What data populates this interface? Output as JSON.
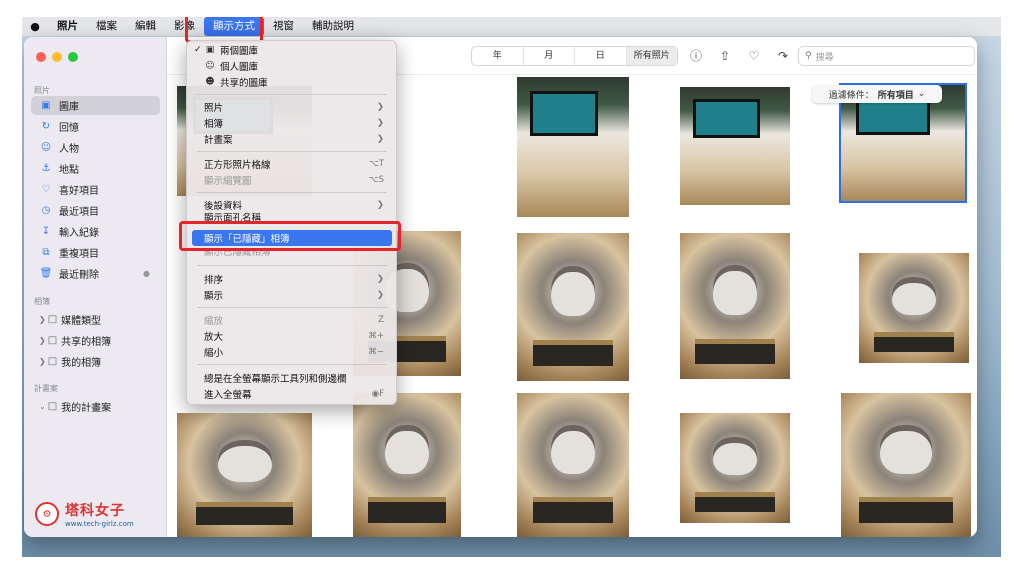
{
  "menubar": {
    "apple": "",
    "items": [
      "照片",
      "檔案",
      "編輯",
      "影像",
      "顯示方式",
      "視窗",
      "輔助說明"
    ]
  },
  "colors": {
    "accent": "#3a76f0",
    "highlight_box": "#e5232b"
  },
  "sidebar": {
    "section_photos": "照片",
    "items": [
      {
        "label": "圖庫",
        "icon": "library-icon"
      },
      {
        "label": "回憶",
        "icon": "memories-icon"
      },
      {
        "label": "人物",
        "icon": "people-icon"
      },
      {
        "label": "地點",
        "icon": "places-icon"
      },
      {
        "label": "喜好項目",
        "icon": "heart-icon"
      },
      {
        "label": "最近項目",
        "icon": "clock-icon"
      },
      {
        "label": "輸入紀錄",
        "icon": "import-icon"
      },
      {
        "label": "重複項目",
        "icon": "duplicates-icon"
      },
      {
        "label": "最近刪除",
        "icon": "trash-icon"
      }
    ],
    "section_albums": "相簿",
    "albums": [
      {
        "label": "媒體類型"
      },
      {
        "label": "共享的相簿"
      },
      {
        "label": "我的相簿"
      }
    ],
    "section_projects": "計畫案",
    "projects": [
      {
        "label": "我的計畫案"
      }
    ]
  },
  "toolbar": {
    "segments": [
      "年",
      "月",
      "日",
      "所有照片"
    ],
    "search_placeholder": "搜尋"
  },
  "filter": {
    "label": "過濾條件：",
    "value": "所有項目"
  },
  "view_menu": {
    "library_items": [
      {
        "label": "兩個圖庫",
        "checked": true
      },
      {
        "label": "個人圖庫"
      },
      {
        "label": "共享的圖庫"
      }
    ],
    "items1": [
      "照片",
      "相簿",
      "計畫案"
    ],
    "grid_square": {
      "label": "正方形照片格線",
      "shortcut": "⌥T"
    },
    "grid_thumb": {
      "label": "顯示縮覽圖",
      "shortcut": "⌥S"
    },
    "metadata": "後設資料",
    "hidden_names": "顯示面孔名稱",
    "show_hidden": "顯示「已隱藏」相簿",
    "show_hidden_sub": "顯示已隱藏相簿",
    "sort": "排序",
    "show": "顯示",
    "zoom": {
      "label": "縮放",
      "shortcut": "Z"
    },
    "zoom_in": {
      "label": "放大",
      "shortcut": "⌘+"
    },
    "zoom_out": {
      "label": "縮小",
      "shortcut": "⌘−"
    },
    "always_toolbar": "總是在全螢幕顯示工具列和側邊欄",
    "fullscreen": {
      "label": "進入全螢幕",
      "shortcut": "◉F"
    }
  },
  "watermark": {
    "name": "塔科女子",
    "url": "www.tech-girlz.com"
  }
}
